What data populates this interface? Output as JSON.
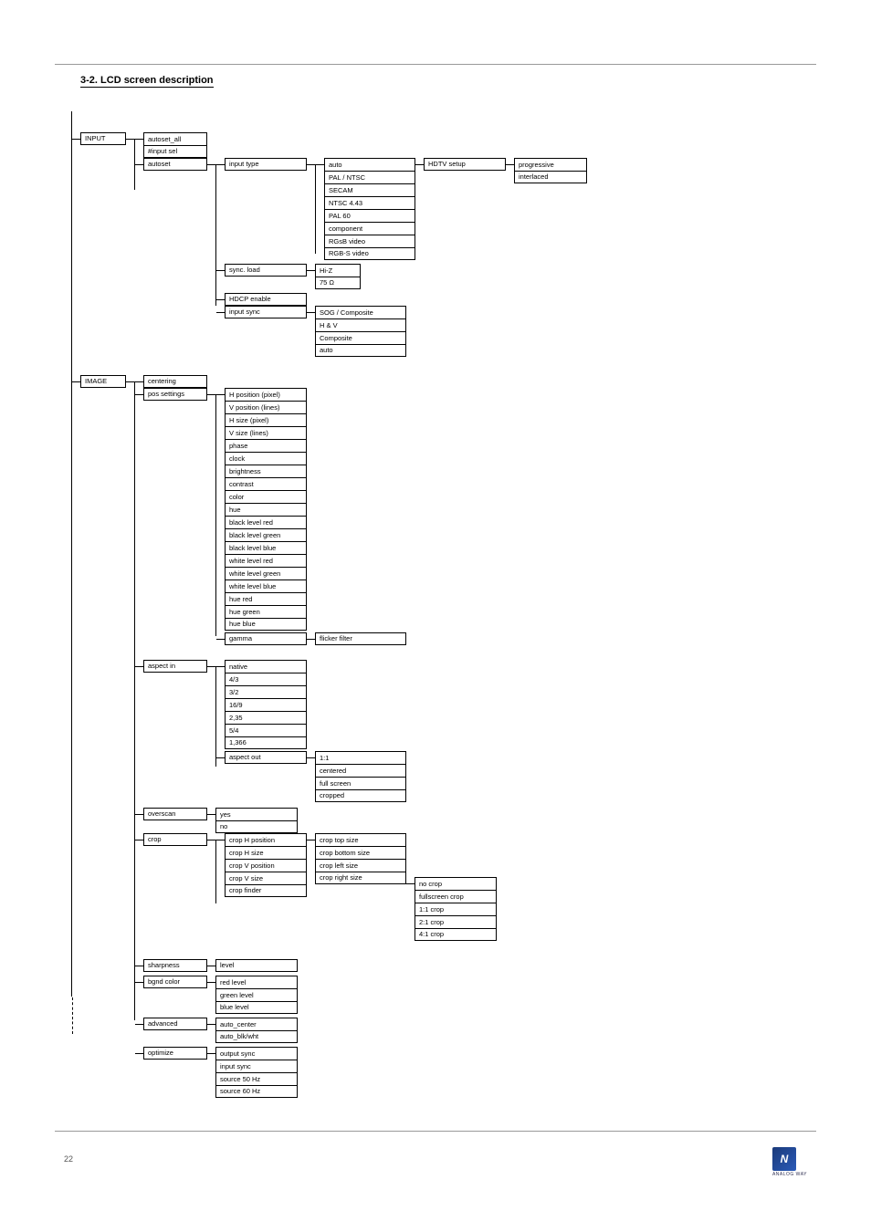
{
  "page": {
    "section_index": "3-2.",
    "section_title": "LCD screen description",
    "footer": "22",
    "logo_text": "ANALOG WAY"
  },
  "tree": {
    "root1": "INPUT",
    "root1_children": {
      "autoset_all": "autoset_all",
      "input_sel": "#input sel",
      "autoset_grp": {
        "label": "autoset",
        "children": {
          "input_type": "input type",
          "input_type_children": [
            "auto",
            "PAL / NTSC",
            "SECAM",
            "NTSC 4.43",
            "PAL 60",
            "component",
            "RGsB video",
            "RGB-S video"
          ],
          "input_type_side": "HDTV setup",
          "input_type_side_items": [
            "progressive",
            "interlaced"
          ],
          "sync_load": "sync. load",
          "sync_load_items": [
            "Hi-Z",
            "75 Ω"
          ],
          "hdcp_enable": "HDCP enable",
          "input_sync": "input sync",
          "input_sync_items": [
            "SOG / Composite",
            "H & V",
            "Composite",
            "auto"
          ]
        }
      }
    },
    "root2": "IMAGE",
    "root2_children": {
      "centering": "centering",
      "pos_settings": {
        "label": "pos settings",
        "items": [
          "H position (pixel)",
          "V position (lines)",
          "H size (pixel)",
          "V size (lines)",
          "phase",
          "clock",
          "brightness",
          "contrast",
          "color",
          "hue",
          "black level red",
          "black level green",
          "black level blue",
          "white level red",
          "white level green",
          "white level blue",
          "hue red",
          "hue green",
          "hue blue"
        ],
        "sub": {
          "label": "gamma",
          "items": [
            "flicker filter"
          ]
        }
      },
      "aspect_in": {
        "label": "aspect in",
        "items": [
          "native",
          "4/3",
          "3/2",
          "16/9",
          "2,35",
          "5/4",
          "1,366"
        ],
        "sub": {
          "label": "aspect out",
          "items": [
            "1:1",
            "centered",
            "full screen",
            "cropped"
          ]
        }
      },
      "overscan": {
        "label": "overscan",
        "items": [
          "yes",
          "no"
        ]
      },
      "crop": {
        "label": "crop",
        "items": [
          {
            "name": "crop H position",
            "extras": [
              "crop top size"
            ]
          },
          {
            "name": "crop H size",
            "extras": [
              "crop bottom size"
            ]
          },
          {
            "name": "crop V position",
            "extras": [
              "crop left size"
            ]
          },
          {
            "name": "crop V size",
            "extras": [
              "crop right size"
            ]
          },
          {
            "name": "crop finder",
            "deep": [
              "no crop",
              "fullscreen crop",
              "1:1 crop",
              "2:1 crop",
              "4:1 crop"
            ]
          }
        ]
      },
      "sharpness": {
        "label": "sharpness",
        "items": [
          "level"
        ]
      },
      "bgnd_color": {
        "label": "bgnd color",
        "items": [
          "red level",
          "green level",
          "blue level"
        ]
      },
      "advanced": {
        "label": "advanced",
        "items": [
          "auto_center",
          "auto_blk/wht"
        ]
      },
      "optimize": {
        "label": "optimize",
        "items": [
          "output sync",
          "input sync",
          "source 50 Hz",
          "source 60 Hz"
        ]
      }
    }
  }
}
